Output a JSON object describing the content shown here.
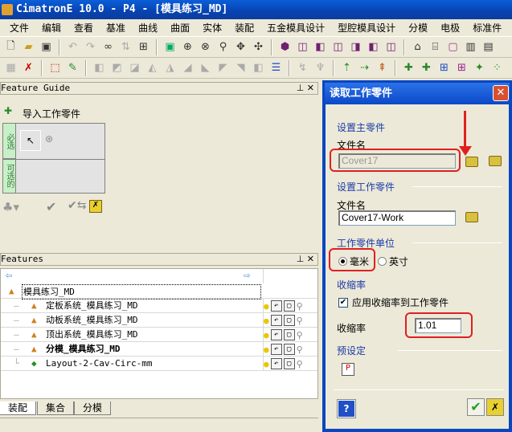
{
  "window": {
    "title": "CimatronE 10.0 - P4 - [模具练习_MD]"
  },
  "menu": [
    "文件",
    "编辑",
    "查看",
    "基准",
    "曲线",
    "曲面",
    "实体",
    "装配",
    "五金模具设计",
    "型腔模具设计",
    "分模",
    "电极",
    "标准件"
  ],
  "feature_guide": {
    "title": "Feature Guide",
    "command": "导入工作零件",
    "required_label": "必选",
    "optional_label": "可选的"
  },
  "features": {
    "title": "Features",
    "root": "模具练习_MD",
    "items": [
      {
        "label": "定板系统_模具练习_MD",
        "bold": false
      },
      {
        "label": "动板系统_模具练习_MD",
        "bold": false
      },
      {
        "label": "顶出系统_模具练习_MD",
        "bold": false
      },
      {
        "label": "分模_模具练习_MD",
        "bold": true
      },
      {
        "label": "Layout-2-Cav-Circ-mm",
        "bold": false
      }
    ]
  },
  "tabs": [
    "装配",
    "集合",
    "分模"
  ],
  "dialog": {
    "title": "读取工作零件",
    "main_section": "设置主零件",
    "main_file_label": "文件名",
    "main_file_value": "Cover17",
    "work_section": "设置工作零件",
    "work_file_label": "文件名",
    "work_file_value": "Cover17-Work",
    "unit_section": "工作零件单位",
    "unit_mm": "毫米",
    "unit_inch": "英寸",
    "unit_selected": "毫米",
    "shrink_section": "收缩率",
    "apply_shrink_label": "应用收缩率到工作零件",
    "apply_shrink_checked": true,
    "shrink_label": "收缩率",
    "shrink_value": "1.01",
    "preset_section": "预设定",
    "help": "?"
  },
  "colors": {
    "title_blue": "#0a46c0",
    "annotation_red": "#e02020",
    "section_blue": "#1a3aa8"
  }
}
